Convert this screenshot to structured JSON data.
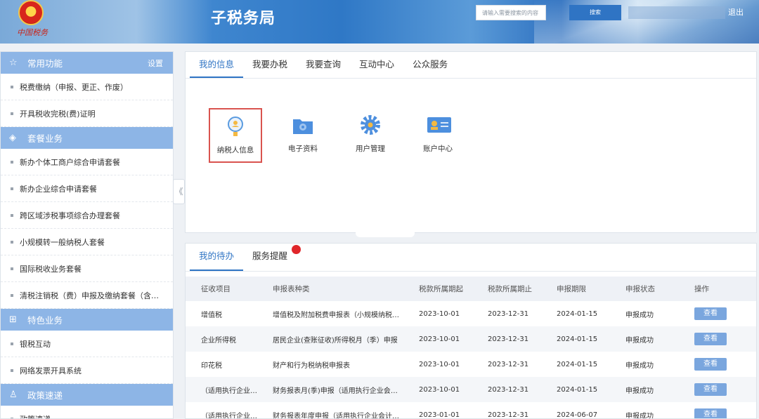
{
  "header": {
    "emblem_text": "中国税务",
    "site_title": "子税务局",
    "search_placeholder": "请输入需要搜索的内容",
    "search_button": "搜索",
    "logout": "退出"
  },
  "sidebar": {
    "sections": [
      {
        "title": "常用功能",
        "icon": "star-icon",
        "setting": "设置",
        "items": [
          "税费缴纳（申报、更正、作废）",
          "开具税收完税(费)证明"
        ]
      },
      {
        "title": "套餐业务",
        "icon": "layers-icon",
        "items": [
          "新办个体工商户综合申请套餐",
          "新办企业综合申请套餐",
          "跨区域涉税事项综合办理套餐",
          "小规模转一般纳税人套餐",
          "国际税收业务套餐",
          "清税注销税（费）申报及缴纳套餐（含…"
        ]
      },
      {
        "title": "特色业务",
        "icon": "grid-icon",
        "items": [
          "银税互动",
          "网络发票开具系统"
        ]
      },
      {
        "title": "政策速递",
        "icon": "person-icon",
        "items": [
          "政策速递"
        ]
      }
    ],
    "collapse_glyph": "《"
  },
  "info_panel": {
    "tabs": [
      "我的信息",
      "我要办税",
      "我要查询",
      "互动中心",
      "公众服务"
    ],
    "active_tab": "我的信息",
    "functions": [
      {
        "label": "纳税人信息",
        "icon": "taxpayer-info-icon",
        "selected": true
      },
      {
        "label": "电子资料",
        "icon": "folder-icon",
        "selected": false
      },
      {
        "label": "用户管理",
        "icon": "gear-icon",
        "selected": false
      },
      {
        "label": "账户中心",
        "icon": "id-card-icon",
        "selected": false
      }
    ]
  },
  "todo_panel": {
    "tabs": [
      "我的待办",
      "服务提醒"
    ],
    "active_tab": "我的待办",
    "columns": [
      "征收项目",
      "申报表种类",
      "税款所属期起",
      "税款所属期止",
      "申报期限",
      "申报状态",
      "操作"
    ],
    "rows": [
      [
        "增值税",
        "增值税及附加税费申报表（小规模纳税…",
        "2023-10-01",
        "2023-12-31",
        "2024-01-15",
        "申报成功",
        "查看"
      ],
      [
        "企业所得税",
        "居民企业(查账征收)所得税月（季）申报",
        "2023-10-01",
        "2023-12-31",
        "2024-01-15",
        "申报成功",
        "查看"
      ],
      [
        "印花税",
        "财产和行为税纳税申报表",
        "2023-10-01",
        "2023-12-31",
        "2024-01-15",
        "申报成功",
        "查看"
      ],
      [
        "（适用执行企业…",
        "财务报表月(季)申报（适用执行企业会计…",
        "2023-10-01",
        "2023-12-31",
        "2024-01-15",
        "申报成功",
        "查看"
      ],
      [
        "（适用执行企业…",
        "财务报表年度申报（适用执行企业会计…",
        "2023-01-01",
        "2023-12-31",
        "2024-06-07",
        "申报成功",
        "查看"
      ]
    ]
  },
  "colors": {
    "accent": "#2f74c4",
    "sidebar_header": "#8db5e6",
    "highlight_border": "#d9534f",
    "badge": "#e0262a"
  }
}
